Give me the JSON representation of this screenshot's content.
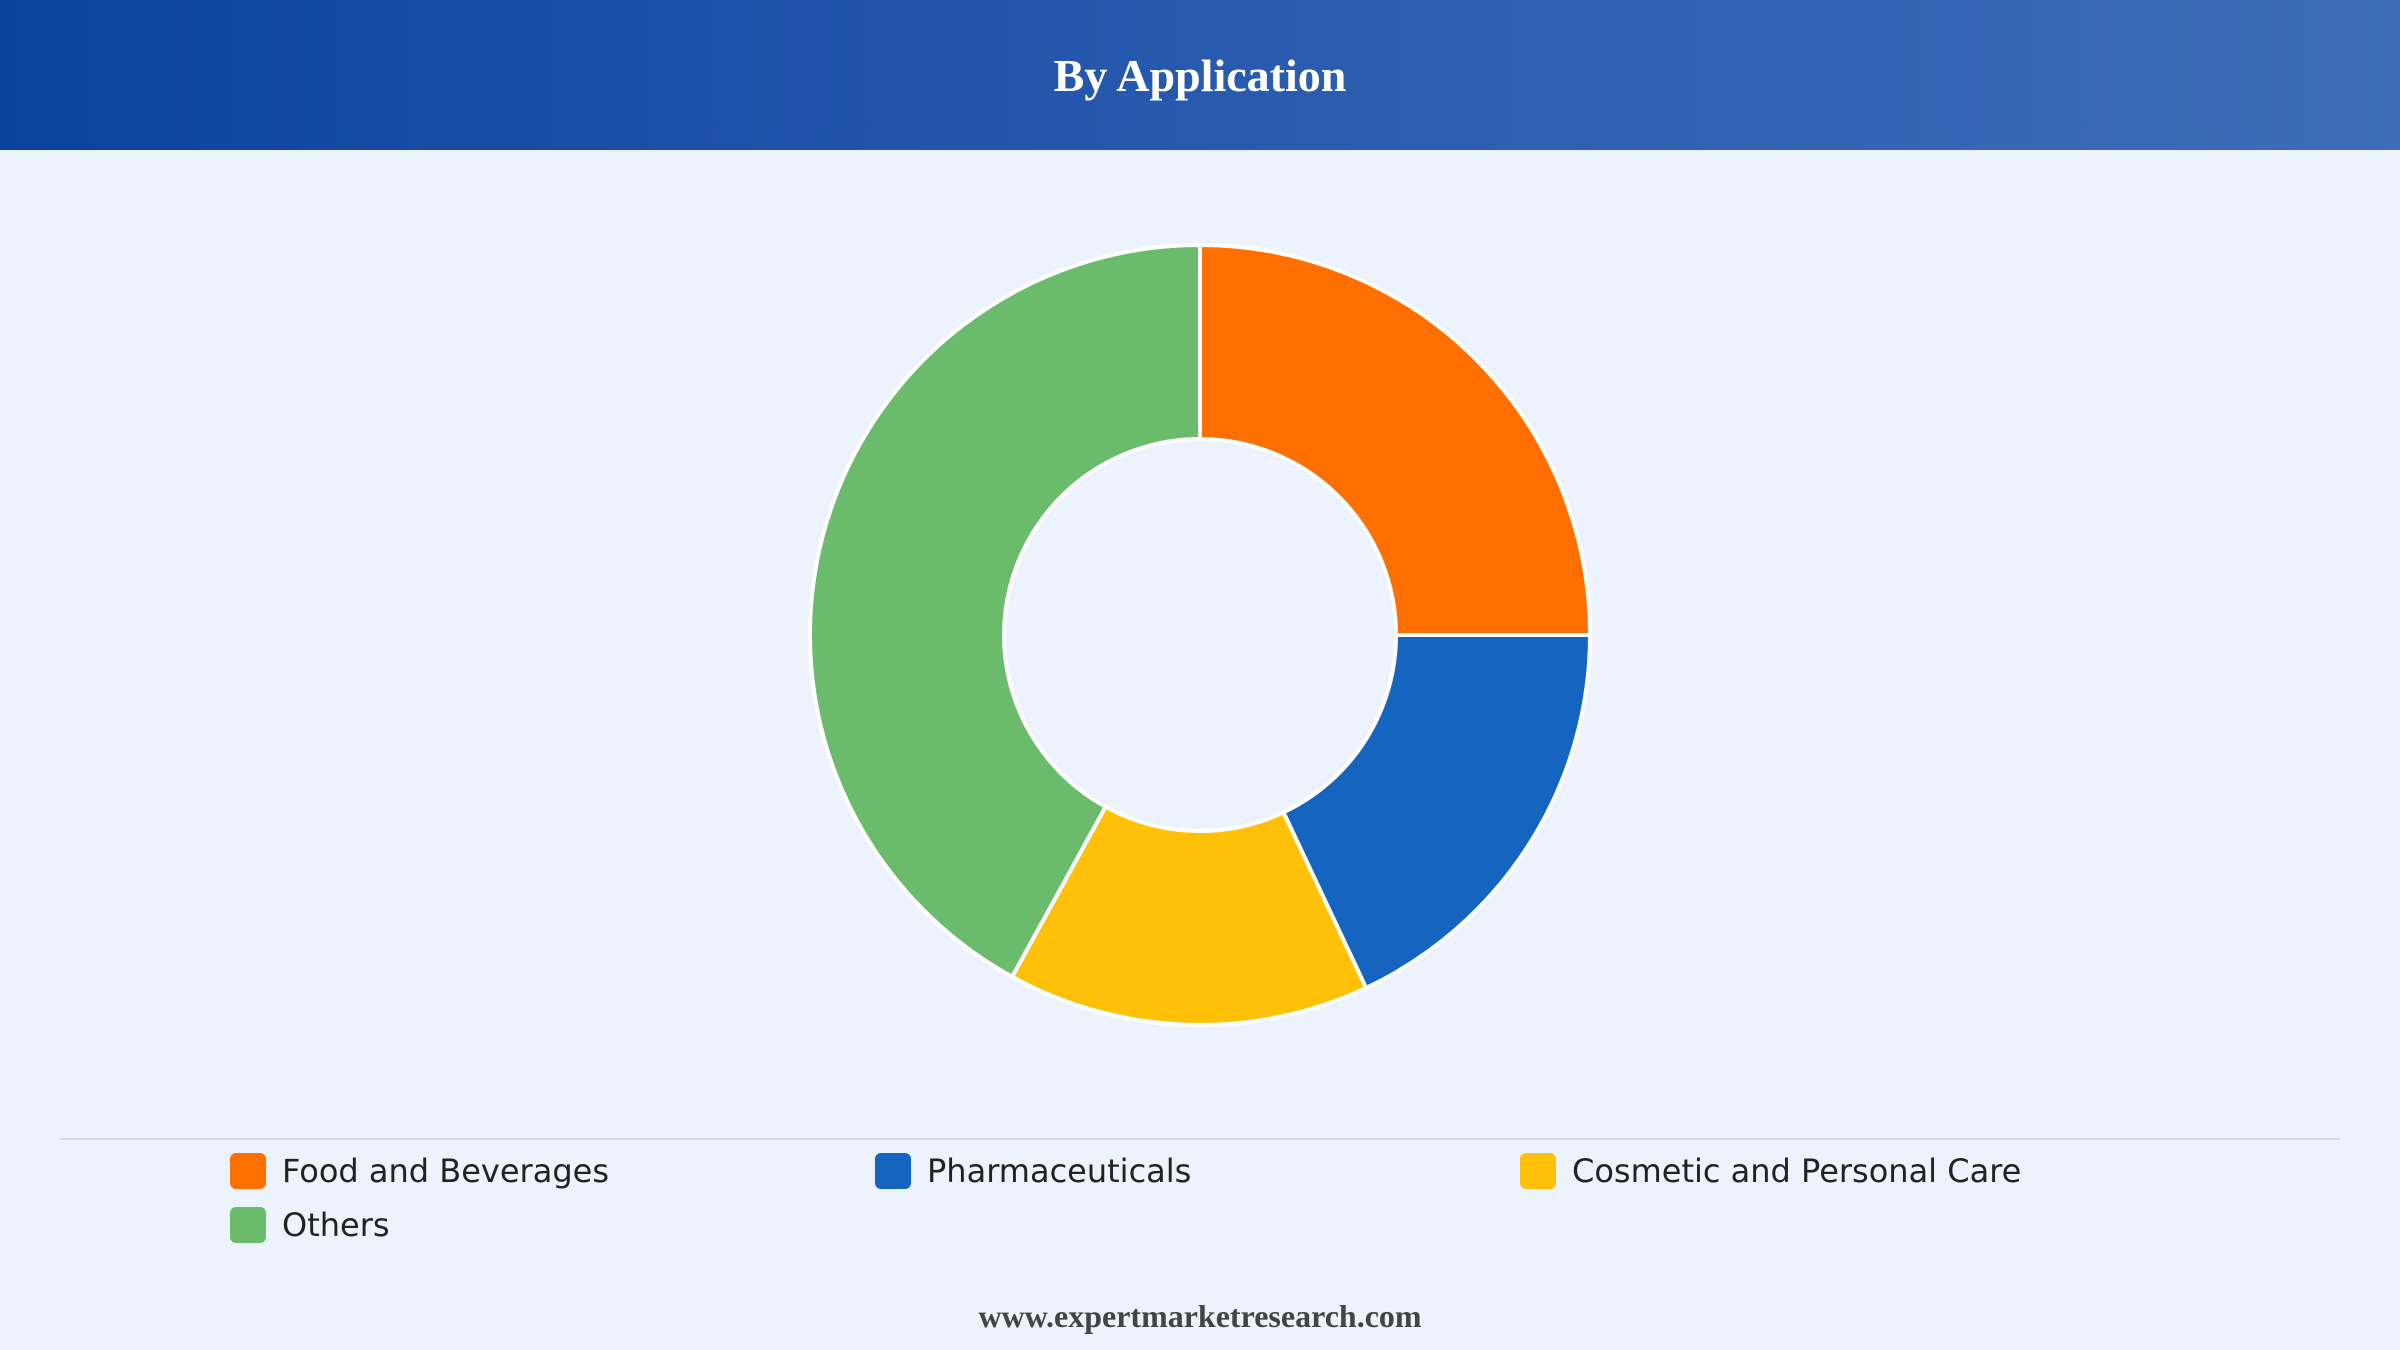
{
  "header": {
    "title": "By Application"
  },
  "footer": {
    "text": "www.expertmarketresearch.com"
  },
  "chart_data": {
    "type": "pie",
    "donut": true,
    "title": "By Application",
    "categories": [
      "Food and Beverages",
      "Pharmaceuticals",
      "Cosmetic and Personal Care",
      "Others"
    ],
    "values": [
      25,
      18,
      15,
      42
    ],
    "colors": [
      "#ff6f00",
      "#1565c0",
      "#ffc107",
      "#6abb6b"
    ],
    "legend_position": "bottom"
  }
}
